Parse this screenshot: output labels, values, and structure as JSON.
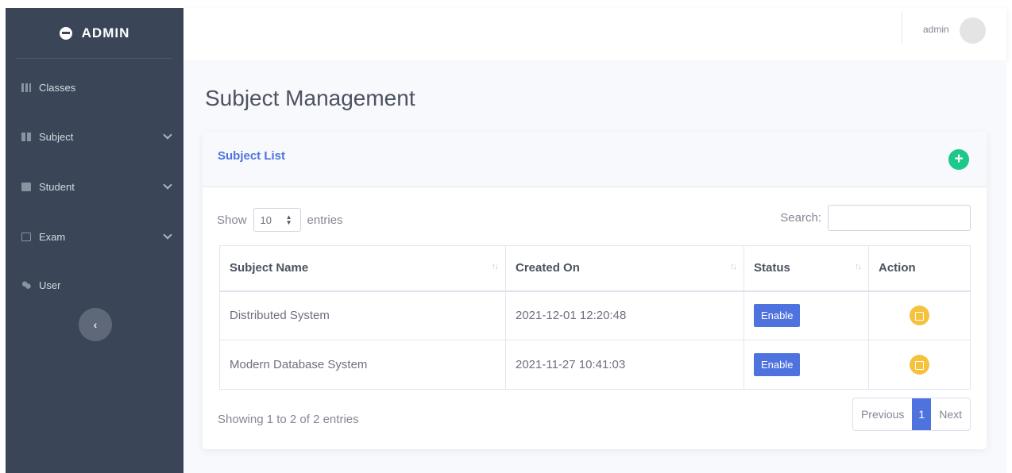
{
  "sidebar": {
    "brand": "ADMIN",
    "items": [
      {
        "label": "Classes",
        "icon": "building-icon",
        "has_submenu": false
      },
      {
        "label": "Subject",
        "icon": "book-icon",
        "has_submenu": true
      },
      {
        "label": "Student",
        "icon": "id-card-icon",
        "has_submenu": true
      },
      {
        "label": "Exam",
        "icon": "edit-icon",
        "has_submenu": true
      },
      {
        "label": "User",
        "icon": "users-icon",
        "has_submenu": false
      }
    ],
    "toggle_label": "‹"
  },
  "topbar": {
    "username": "admin"
  },
  "page": {
    "title": "Subject Management"
  },
  "card": {
    "title": "Subject List",
    "add_label": "+"
  },
  "table_controls": {
    "show_label": "Show",
    "entries_value": "10",
    "entries_label": "entries",
    "search_label": "Search:",
    "search_value": ""
  },
  "table": {
    "headers": [
      "Subject Name",
      "Created On",
      "Status",
      "Action"
    ],
    "rows": [
      {
        "name": "Distributed System",
        "created": "2021-12-01 12:20:48",
        "status": "Enable"
      },
      {
        "name": "Modern Database System",
        "created": "2021-11-27 10:41:03",
        "status": "Enable"
      }
    ]
  },
  "footer": {
    "info": "Showing 1 to 2 of 2 entries",
    "previous": "Previous",
    "current_page": "1",
    "next": "Next"
  },
  "colors": {
    "sidebar_bg": "#3a4658",
    "primary": "#4e73df",
    "success": "#1cc88a",
    "warning": "#f6c23e"
  }
}
